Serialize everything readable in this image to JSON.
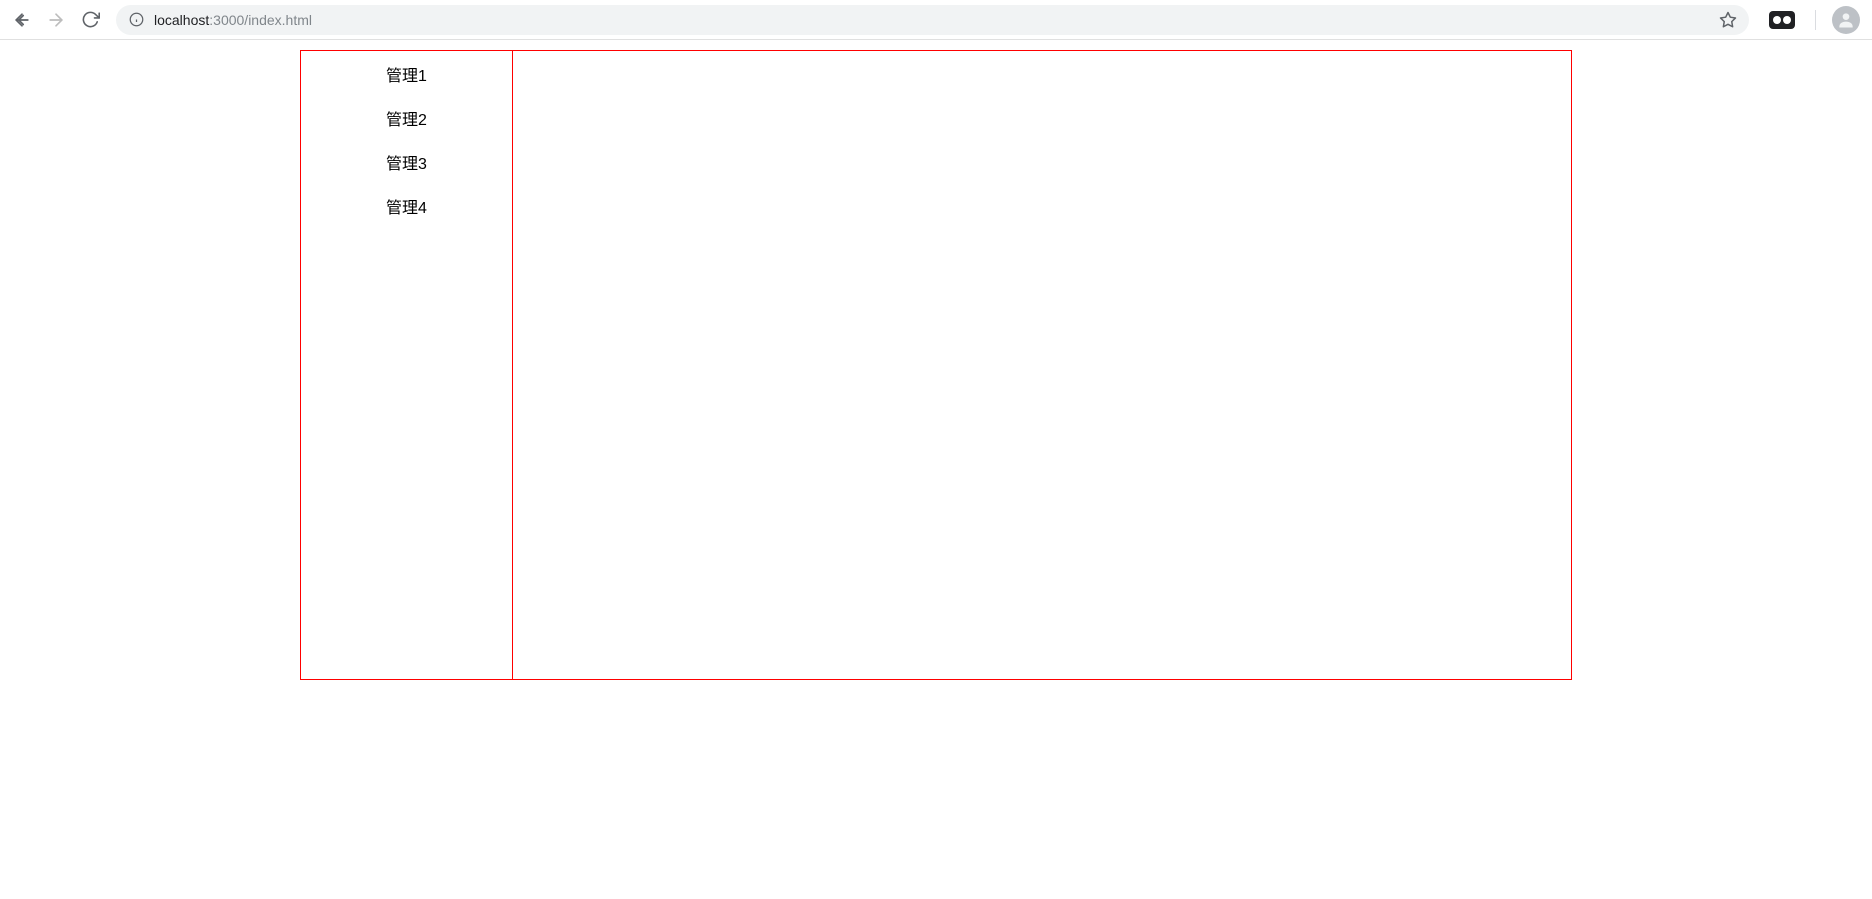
{
  "browser": {
    "url_host": "localhost",
    "url_port_path": ":3000/index.html"
  },
  "sidebar": {
    "items": [
      {
        "label": "管理1"
      },
      {
        "label": "管理2"
      },
      {
        "label": "管理3"
      },
      {
        "label": "管理4"
      }
    ]
  }
}
